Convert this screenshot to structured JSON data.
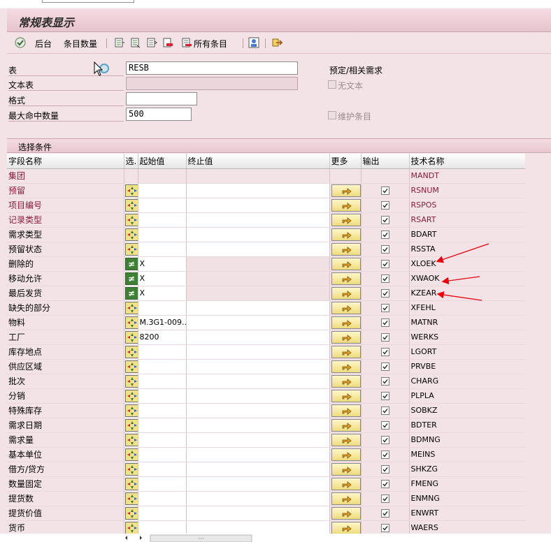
{
  "window": {
    "title": "常规表显示"
  },
  "toolbar": {
    "back_label": "后台",
    "count_label": "条目数量",
    "all_entries_label": "所有条目"
  },
  "form": {
    "table_label": "表",
    "table_value": "RESB",
    "text_table_label": "文本表",
    "text_table_value": "",
    "format_label": "格式",
    "format_value": "",
    "max_hits_label": "最大命中数量",
    "max_hits_value": "500",
    "predef_label": "预定/相关需求",
    "no_text_label": "无文本",
    "maintain_entries_label": "维护条目"
  },
  "section": {
    "title": "选择条件"
  },
  "grid": {
    "headers": {
      "name": "字段名称",
      "sel": "选.",
      "low": "起始值",
      "high": "终止值",
      "more": "更多",
      "out": "输出",
      "tech": "技术名称"
    },
    "rows": [
      {
        "name": "集团",
        "low": "",
        "tech": "MANDT"
      },
      {
        "name": "预留",
        "low": "",
        "tech": "RSNUM"
      },
      {
        "name": "项目编号",
        "low": "",
        "tech": "RSPOS"
      },
      {
        "name": "记录类型",
        "low": "",
        "tech": "RSART"
      },
      {
        "name": "需求类型",
        "low": "",
        "tech": "BDART"
      },
      {
        "name": "预留状态",
        "low": "",
        "tech": "RSSTA"
      },
      {
        "name": "删除的",
        "low": "X",
        "tech": "XLOEK"
      },
      {
        "name": "移动允许",
        "low": "X",
        "tech": "XWAOK"
      },
      {
        "name": "最后发货",
        "low": "X",
        "tech": "KZEAR"
      },
      {
        "name": "缺失的部分",
        "low": "",
        "tech": "XFEHL"
      },
      {
        "name": "物料",
        "low": "M.3G1-009...",
        "tech": "MATNR"
      },
      {
        "name": "工厂",
        "low": "8200",
        "tech": "WERKS"
      },
      {
        "name": "库存地点",
        "low": "",
        "tech": "LGORT"
      },
      {
        "name": "供应区域",
        "low": "",
        "tech": "PRVBE"
      },
      {
        "name": "批次",
        "low": "",
        "tech": "CHARG"
      },
      {
        "name": "分销",
        "low": "",
        "tech": "PLPLA"
      },
      {
        "name": "特殊库存",
        "low": "",
        "tech": "SOBKZ"
      },
      {
        "name": "需求日期",
        "low": "",
        "tech": "BDTER"
      },
      {
        "name": "需求量",
        "low": "",
        "tech": "BDMNG"
      },
      {
        "name": "基本单位",
        "low": "",
        "tech": "MEINS"
      },
      {
        "name": "借方/贷方",
        "low": "",
        "tech": "SHKZG"
      },
      {
        "name": "数量固定",
        "low": "",
        "tech": "FMENG"
      },
      {
        "name": "提货数",
        "low": "",
        "tech": "ENMNG"
      },
      {
        "name": "提货价值",
        "low": "",
        "tech": "ENWRT"
      },
      {
        "name": "货币",
        "low": "",
        "tech": "WAERS"
      }
    ]
  },
  "colors": {
    "accent_key": "#8b1a3a",
    "annotation_arrow": "#e8000d",
    "bg": "#f3e3e7"
  }
}
